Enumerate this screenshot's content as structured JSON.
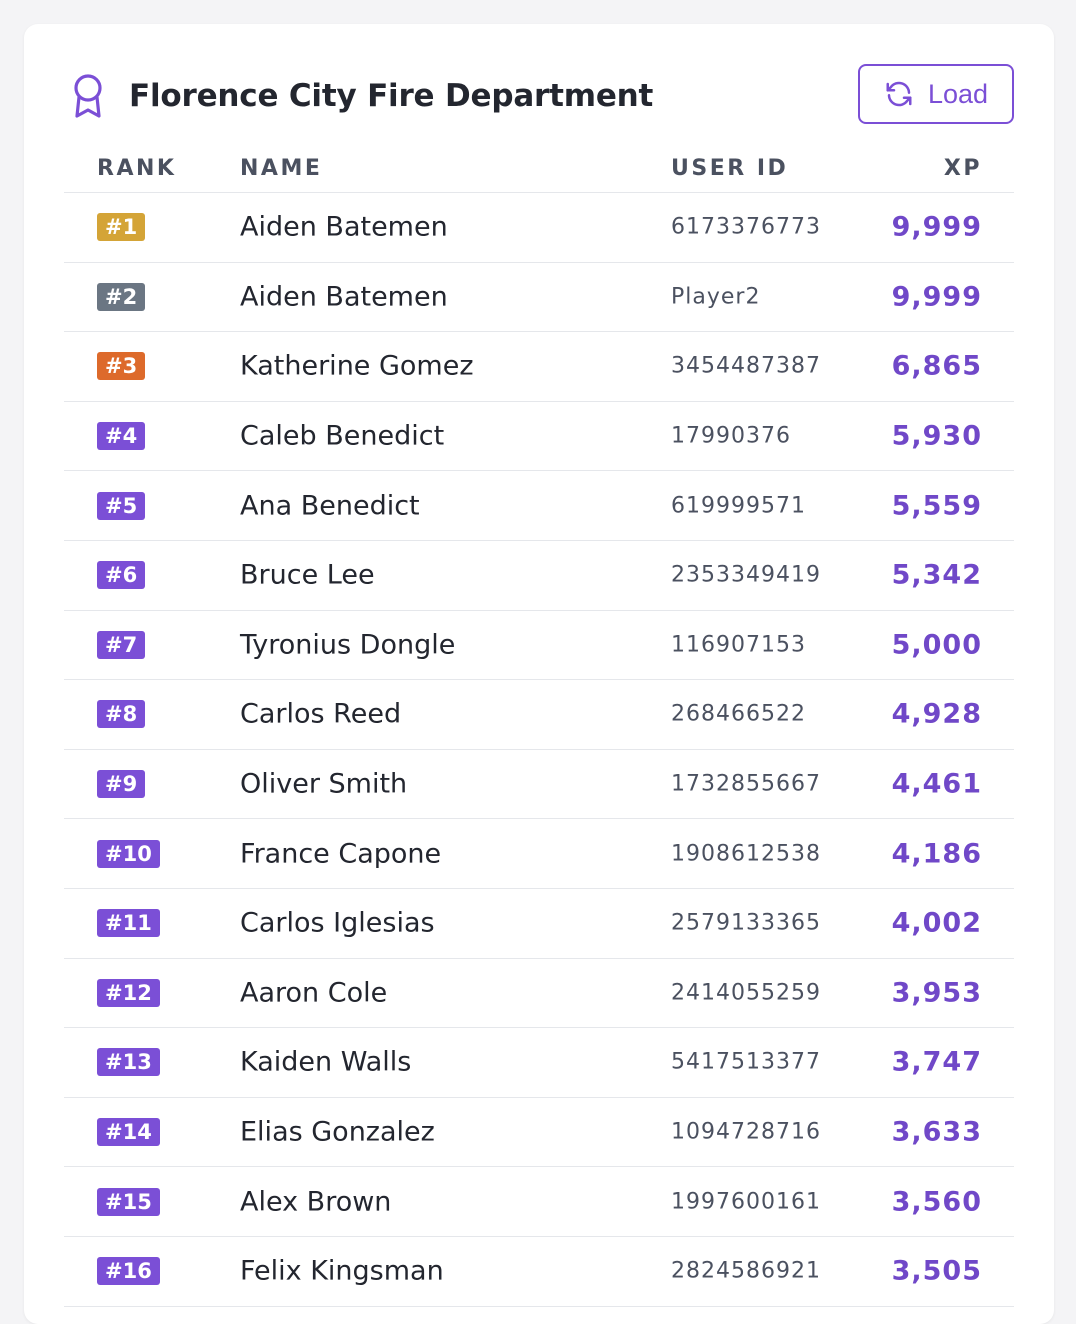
{
  "leaderboard": {
    "title": "Florence City Fire Department",
    "load_label": "Load",
    "columns": {
      "rank": "RANK",
      "name": "NAME",
      "user_id": "USER ID",
      "xp": "XP"
    },
    "colors": {
      "accent": "#7b4fd6",
      "gold": "#d4a437",
      "silver": "#6b7683",
      "bronze": "#dd6a2b"
    },
    "rows": [
      {
        "rank": "#1",
        "name": "Aiden Batemen",
        "user_id": "6173376773",
        "xp": "9,999",
        "tier": "gold"
      },
      {
        "rank": "#2",
        "name": "Aiden Batemen",
        "user_id": "Player2",
        "xp": "9,999",
        "tier": "silver"
      },
      {
        "rank": "#3",
        "name": "Katherine Gomez",
        "user_id": "3454487387",
        "xp": "6,865",
        "tier": "bronze"
      },
      {
        "rank": "#4",
        "name": "Caleb Benedict",
        "user_id": "17990376",
        "xp": "5,930",
        "tier": "default"
      },
      {
        "rank": "#5",
        "name": "Ana Benedict",
        "user_id": "619999571",
        "xp": "5,559",
        "tier": "default"
      },
      {
        "rank": "#6",
        "name": "Bruce Lee",
        "user_id": "2353349419",
        "xp": "5,342",
        "tier": "default"
      },
      {
        "rank": "#7",
        "name": "Tyronius Dongle",
        "user_id": "116907153",
        "xp": "5,000",
        "tier": "default"
      },
      {
        "rank": "#8",
        "name": "Carlos Reed",
        "user_id": "268466522",
        "xp": "4,928",
        "tier": "default"
      },
      {
        "rank": "#9",
        "name": "Oliver Smith",
        "user_id": "1732855667",
        "xp": "4,461",
        "tier": "default"
      },
      {
        "rank": "#10",
        "name": "France Capone",
        "user_id": "1908612538",
        "xp": "4,186",
        "tier": "default"
      },
      {
        "rank": "#11",
        "name": "Carlos Iglesias",
        "user_id": "2579133365",
        "xp": "4,002",
        "tier": "default"
      },
      {
        "rank": "#12",
        "name": "Aaron Cole",
        "user_id": "2414055259",
        "xp": "3,953",
        "tier": "default"
      },
      {
        "rank": "#13",
        "name": "Kaiden Walls",
        "user_id": "5417513377",
        "xp": "3,747",
        "tier": "default"
      },
      {
        "rank": "#14",
        "name": "Elias Gonzalez",
        "user_id": "1094728716",
        "xp": "3,633",
        "tier": "default"
      },
      {
        "rank": "#15",
        "name": "Alex Brown",
        "user_id": "1997600161",
        "xp": "3,560",
        "tier": "default"
      },
      {
        "rank": "#16",
        "name": "Felix Kingsman",
        "user_id": "2824586921",
        "xp": "3,505",
        "tier": "default"
      }
    ]
  }
}
